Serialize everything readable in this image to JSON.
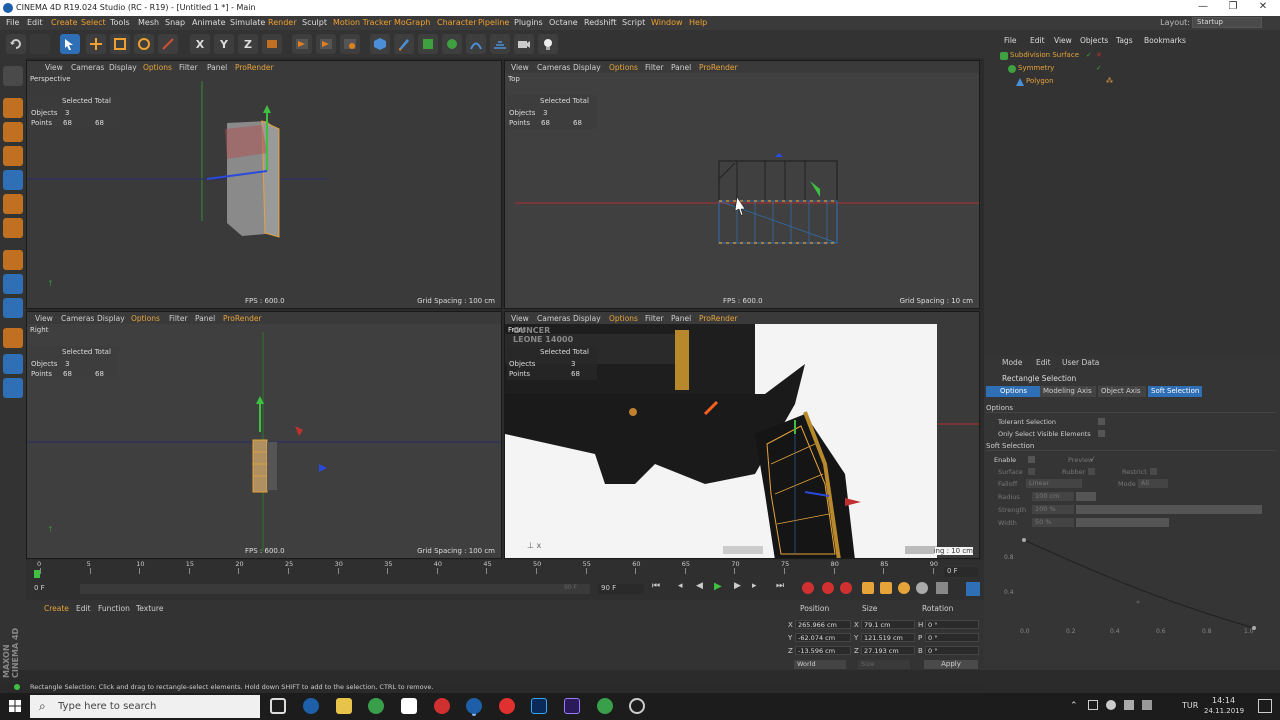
{
  "window": {
    "title": "CINEMA 4D R19.024 Studio (RC - R19) - [Untitled 1 *] - Main"
  },
  "menubar": {
    "items": [
      "File",
      "Edit",
      "Create",
      "Select",
      "Tools",
      "Mesh",
      "Snap",
      "Animate",
      "Simulate",
      "Render",
      "Sculpt",
      "Motion Tracker",
      "MoGraph",
      "Character",
      "Pipeline",
      "Plugins",
      "Octane",
      "Redshift",
      "Script",
      "Window",
      "Help"
    ],
    "layout_label": "Layout:",
    "layout_value": "Startup"
  },
  "toolbar": {
    "icons": [
      "undo-icon",
      "redo-icon",
      "live-selection-icon",
      "move-icon",
      "scale-icon",
      "rotate-icon",
      "recent-tools-icon",
      "x-axis-icon",
      "y-axis-icon",
      "z-axis-icon",
      "coordinate-system-icon",
      "render-view-icon",
      "render-picture-viewer-icon",
      "edit-render-settings-icon",
      "cube-icon",
      "pen-icon",
      "subdivision-surface-icon",
      "array-icon",
      "deformer-icon",
      "environment-icon",
      "camera-icon",
      "light-icon"
    ],
    "axis_labels": [
      "X",
      "Y",
      "Z"
    ]
  },
  "viewports": {
    "menu": [
      "View",
      "Cameras",
      "Display",
      "Options",
      "Filter",
      "Panel",
      "ProRender"
    ],
    "stats": {
      "header": "Selected Total",
      "objects_label": "Objects",
      "objects_sel": "3",
      "points_label": "Points",
      "points_sel": "68",
      "points_total": "68"
    },
    "perspective": {
      "name": "Perspective",
      "fps": "FPS : 600.0",
      "grid": "Grid Spacing : 100 cm"
    },
    "top": {
      "name": "Top",
      "fps": "FPS : 600.0",
      "grid": "Grid Spacing : 10 cm"
    },
    "right": {
      "name": "Right",
      "fps": "FPS : 600.0",
      "grid": "Grid Spacing : 100 cm"
    },
    "front": {
      "name": "Front",
      "grid": "ing : 10 cm",
      "watermark": "GUNCER LEONE 14000"
    }
  },
  "object_manager": {
    "menu": [
      "File",
      "Edit",
      "View",
      "Objects",
      "Tags",
      "Bookmarks"
    ],
    "objects": [
      {
        "name": "Subdivision Surface",
        "color": "#e6a33a"
      },
      {
        "name": "Symmetry",
        "color": "#e6a33a"
      },
      {
        "name": "Polygon",
        "color": "#e6a33a"
      }
    ]
  },
  "attributes": {
    "menu": [
      "Mode",
      "Edit",
      "User Data"
    ],
    "title": "Rectangle Selection",
    "tabs": [
      "Options",
      "Modeling Axis",
      "Object Axis",
      "Soft Selection"
    ],
    "options_section": "Options",
    "tolerant": "Tolerant Selection",
    "only_visible": "Only Select Visible Elements",
    "soft_section": "Soft Selection",
    "enable": "Enable",
    "preview": "Preview",
    "surface": "Surface",
    "rubber": "Rubber",
    "restrict": "Restrict",
    "falloff_label": "Falloff",
    "falloff_value": "Linear",
    "mode_label": "Mode",
    "mode_value": "All",
    "radius_label": "Radius",
    "radius_value": "100 cm",
    "strength_label": "Strength",
    "strength_value": "100 %",
    "width_label": "Width",
    "width_value": "50 %",
    "graph_y": [
      "0.8",
      "0.4"
    ],
    "graph_x": [
      "0.0",
      "0.2",
      "0.4",
      "0.6",
      "0.8",
      "1.0"
    ]
  },
  "timeline": {
    "ticks": [
      "0",
      "5",
      "10",
      "15",
      "20",
      "25",
      "30",
      "35",
      "40",
      "45",
      "50",
      "55",
      "60",
      "65",
      "70",
      "75",
      "80",
      "85",
      "90"
    ],
    "current_frame": "0 F",
    "start_frame": "0 F",
    "end_frame": "90 F",
    "end_frame2": "90 F",
    "right_frame": "0 F"
  },
  "material_manager": {
    "menu": [
      "Create",
      "Edit",
      "Function",
      "Texture"
    ]
  },
  "coordinates": {
    "headers": [
      "Position",
      "Size",
      "Rotation"
    ],
    "rows": [
      {
        "axis": "X",
        "pos": "265.966 cm",
        "saxis": "X",
        "size": "79.1 cm",
        "raxis": "H",
        "rot": "0 °"
      },
      {
        "axis": "Y",
        "pos": "-62.074 cm",
        "saxis": "Y",
        "size": "121.519 cm",
        "raxis": "P",
        "rot": "0 °"
      },
      {
        "axis": "Z",
        "pos": "-13.596 cm",
        "saxis": "Z",
        "size": "27.193 cm",
        "raxis": "B",
        "rot": "0 °"
      }
    ],
    "mode": "World",
    "size_mode": "Size",
    "apply": "Apply"
  },
  "status": {
    "text": "Rectangle Selection: Click and drag to rectangle-select elements. Hold down SHIFT to add to the selection, CTRL to remove."
  },
  "branding": {
    "logo": "MAXON CINEMA 4D"
  },
  "taskbar": {
    "search_placeholder": "Type here to search",
    "lang": "TUR",
    "time": "14:14",
    "date": "24.11.2019"
  },
  "colors": {
    "accent": "#e6a33a",
    "panel": "#333333",
    "viewport": "#3d3d3d",
    "selection_blue": "#2e6fb5"
  }
}
